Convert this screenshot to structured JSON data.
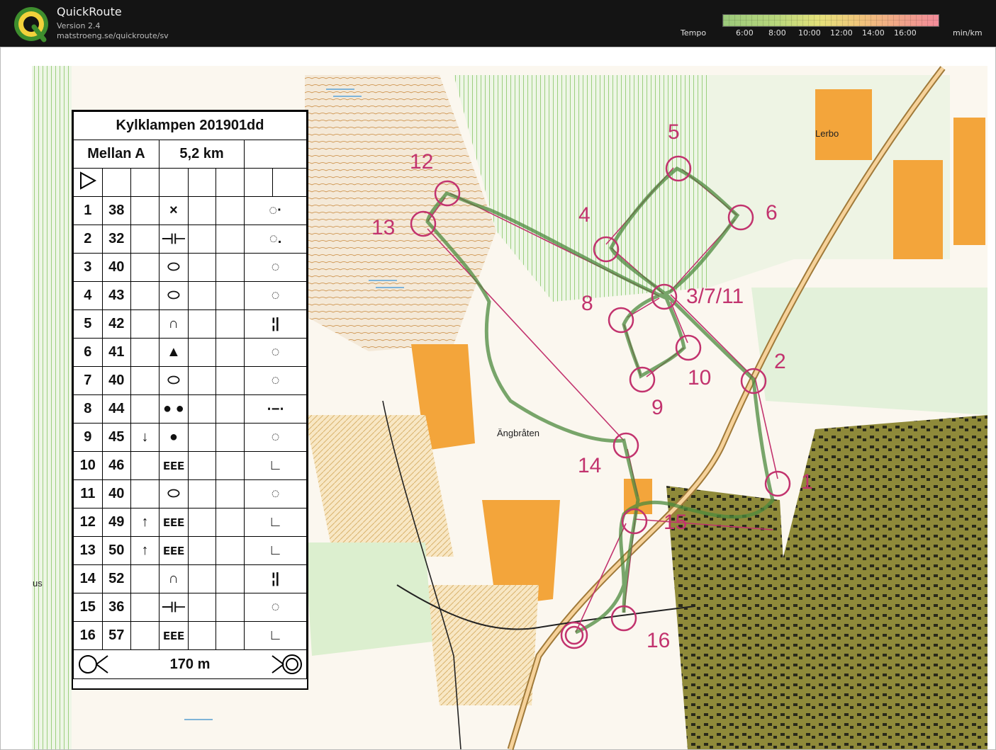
{
  "app": {
    "title": "QuickRoute",
    "version": "Version 2.4",
    "url": "matstroeng.se/quickroute/sv",
    "logo_letter": "Q"
  },
  "tempo": {
    "label": "Tempo",
    "ticks": [
      "6:00",
      "8:00",
      "10:00",
      "12:00",
      "14:00",
      "16:00"
    ],
    "unit": "min/km"
  },
  "course": {
    "title": "Kylklampen 201901dd",
    "class_name": "Mellan A",
    "length": "5,2 km",
    "finish_distance": "170 m",
    "controls": [
      {
        "num": "1",
        "code": "38",
        "dir": "",
        "feature": "×",
        "loc": "◌·"
      },
      {
        "num": "2",
        "code": "32",
        "dir": "",
        "feature": "⊣⊢",
        "loc": "◌."
      },
      {
        "num": "3",
        "code": "40",
        "dir": "",
        "feature": "⬭",
        "loc": "◌"
      },
      {
        "num": "4",
        "code": "43",
        "dir": "",
        "feature": "⬭",
        "loc": "◌"
      },
      {
        "num": "5",
        "code": "42",
        "dir": "",
        "feature": "∩",
        "loc": "¦|"
      },
      {
        "num": "6",
        "code": "41",
        "dir": "",
        "feature": "▲",
        "loc": "◌"
      },
      {
        "num": "7",
        "code": "40",
        "dir": "",
        "feature": "⬭",
        "loc": "◌"
      },
      {
        "num": "8",
        "code": "44",
        "dir": "",
        "feature": "●  ●",
        "loc": "⋅−⋅"
      },
      {
        "num": "9",
        "code": "45",
        "dir": "↓",
        "feature": "●",
        "loc": "◌"
      },
      {
        "num": "10",
        "code": "46",
        "dir": "",
        "feature": "ᴇᴇᴇ",
        "loc": "∟"
      },
      {
        "num": "11",
        "code": "40",
        "dir": "",
        "feature": "⬭",
        "loc": "◌"
      },
      {
        "num": "12",
        "code": "49",
        "dir": "↑",
        "feature": "ᴇᴇᴇ",
        "loc": "∟"
      },
      {
        "num": "13",
        "code": "50",
        "dir": "↑",
        "feature": "ᴇᴇᴇ",
        "loc": "∟"
      },
      {
        "num": "14",
        "code": "52",
        "dir": "",
        "feature": "∩",
        "loc": "¦|"
      },
      {
        "num": "15",
        "code": "36",
        "dir": "",
        "feature": "⊣⊢",
        "loc": "◌"
      },
      {
        "num": "16",
        "code": "57",
        "dir": "",
        "feature": "ᴇᴇᴇ",
        "loc": "∟"
      }
    ]
  },
  "map_labels": {
    "c1": "1",
    "c2": "2",
    "c3_7_11": "3/7/11",
    "c4": "4",
    "c5": "5",
    "c6": "6",
    "c8": "8",
    "c9": "9",
    "c10": "10",
    "c12": "12",
    "c13": "13",
    "c14": "14",
    "c15": "15",
    "c16": "16",
    "place_angbraten": "Ängbråten",
    "place_lerbo": "Lerbo",
    "place_us": "us"
  },
  "colors": {
    "course_magenta": "#c2336e",
    "route_green": "#4c8a3e",
    "forest_white": "#ffffff",
    "open_yellow": "#f3a53b",
    "urban_olive": "#8a8a3e",
    "light_green": "#cde8bc",
    "marsh_blue": "#7fb4d8"
  }
}
